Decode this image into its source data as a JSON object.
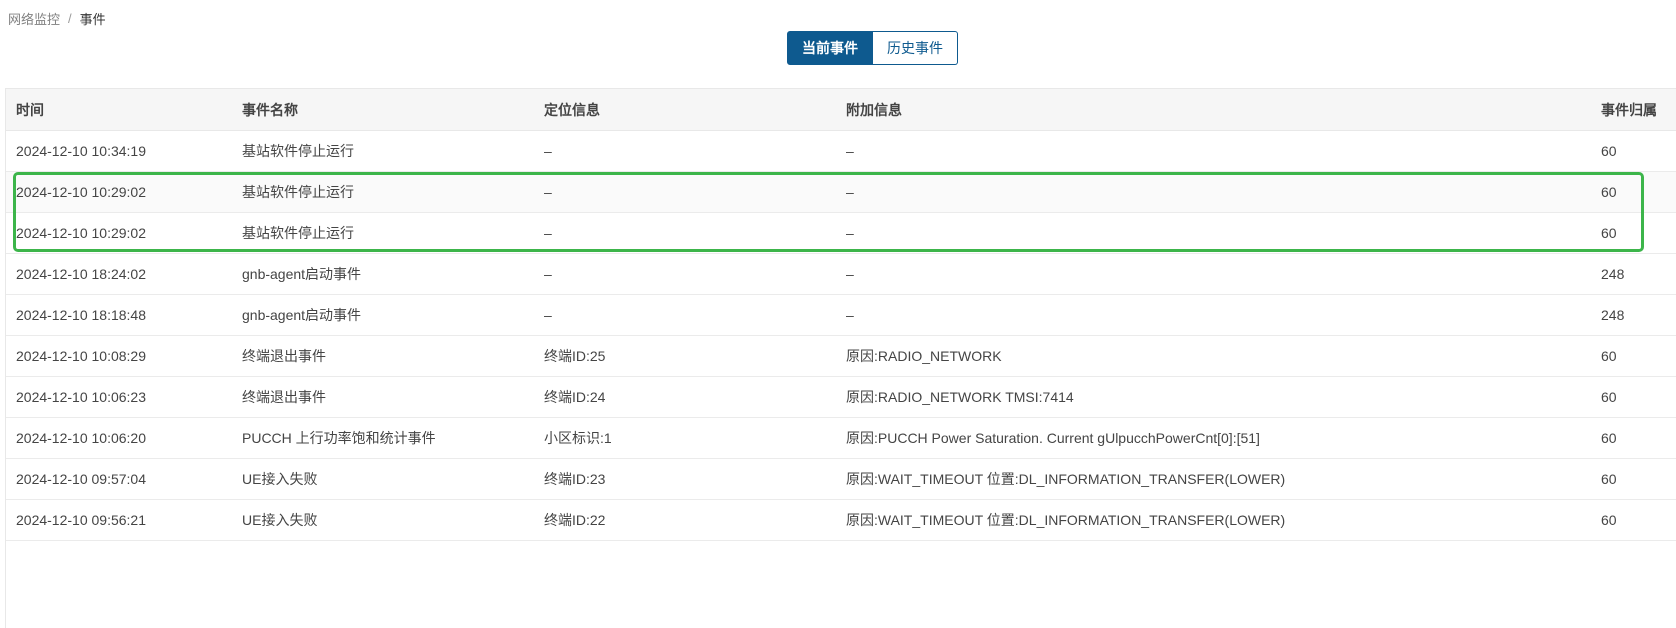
{
  "breadcrumb": {
    "parent": "网络监控",
    "separator": "/",
    "current": "事件"
  },
  "tabs": [
    {
      "label": "当前事件",
      "active": true
    },
    {
      "label": "历史事件",
      "active": false
    }
  ],
  "colors": {
    "accent": "#0e5a8f",
    "highlight": "#3cb54a"
  },
  "table": {
    "headers": [
      "时间",
      "事件名称",
      "定位信息",
      "附加信息",
      "事件归属"
    ],
    "rows": [
      [
        "2024-12-10 10:34:19",
        "基站软件停止运行",
        "–",
        "–",
        "60"
      ],
      [
        "2024-12-10 10:29:02",
        "基站软件停止运行",
        "–",
        "–",
        "60"
      ],
      [
        "2024-12-10 10:29:02",
        "基站软件停止运行",
        "–",
        "–",
        "60"
      ],
      [
        "2024-12-10 18:24:02",
        "gnb-agent启动事件",
        "–",
        "–",
        "248"
      ],
      [
        "2024-12-10 18:18:48",
        "gnb-agent启动事件",
        "–",
        "–",
        "248"
      ],
      [
        "2024-12-10 10:08:29",
        "终端退出事件",
        "终端ID:25",
        "原因:RADIO_NETWORK",
        "60"
      ],
      [
        "2024-12-10 10:06:23",
        "终端退出事件",
        "终端ID:24",
        "原因:RADIO_NETWORK TMSI:7414",
        "60"
      ],
      [
        "2024-12-10 10:06:20",
        "PUCCH 上行功率饱和统计事件",
        "小区标识:1",
        "原因:PUCCH Power Saturation. Current gUlpucchPowerCnt[0]:[51]",
        "60"
      ],
      [
        "2024-12-10 09:57:04",
        "UE接入失败",
        "终端ID:23",
        "原因:WAIT_TIMEOUT 位置:DL_INFORMATION_TRANSFER(LOWER)",
        "60"
      ],
      [
        "2024-12-10 09:56:21",
        "UE接入失败",
        "终端ID:22",
        "原因:WAIT_TIMEOUT 位置:DL_INFORMATION_TRANSFER(LOWER)",
        "60"
      ]
    ]
  }
}
